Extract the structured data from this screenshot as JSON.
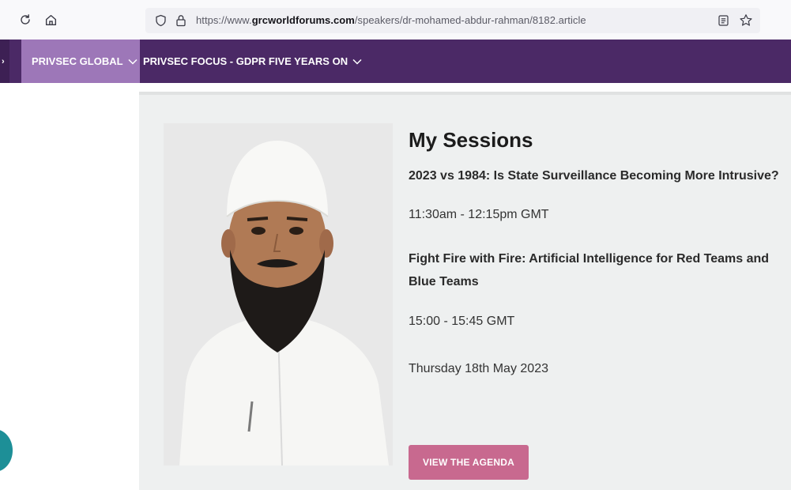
{
  "browser": {
    "url_prefix": "https://www.",
    "url_domain": "grcworldforums.com",
    "url_path": "/speakers/dr-mohamed-abdur-rahman/8182.article",
    "icons": [
      "reload-icon",
      "home-icon",
      "shield-icon",
      "lock-icon",
      "reader-view-icon",
      "bookmark-star-icon"
    ]
  },
  "nav": {
    "items": [
      {
        "label": "PRIVSEC GLOBAL",
        "active": true
      },
      {
        "label": "PRIVSEC FOCUS - GDPR FIVE YEARS ON",
        "active": false
      }
    ]
  },
  "sessions": {
    "heading": "My Sessions",
    "items": [
      {
        "title": "2023 vs 1984: Is State Surveillance Becoming More Intrusive?",
        "time": "11:30am - 12:15pm GMT"
      },
      {
        "title": "Fight Fire with Fire: Artificial Intelligence for Red Teams and Blue Teams",
        "time": "15:00 - 15:45 GMT"
      }
    ],
    "date": "Thursday 18th May 2023",
    "cta_label": "VIEW THE AGENDA"
  },
  "colors": {
    "nav_bg": "#4b2966",
    "nav_active": "#9d77b8",
    "cta": "#c8698f",
    "card_bg": "#eef0f0",
    "chat_bubble": "#1d8f97"
  }
}
